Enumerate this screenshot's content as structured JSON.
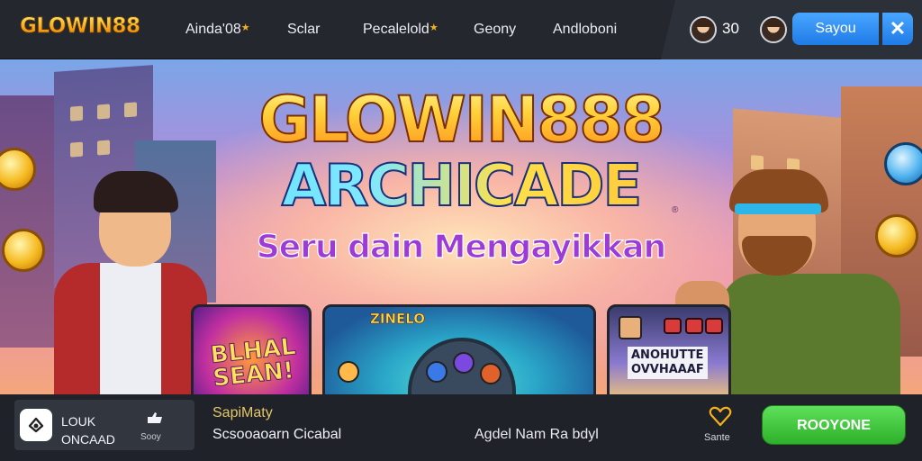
{
  "brand": {
    "logo_text": "GLOWIN88"
  },
  "nav": {
    "items": [
      {
        "label": "Ainda'08",
        "star": true
      },
      {
        "label": "Sclar",
        "star": false
      },
      {
        "label": "Pecalelold",
        "star": true
      },
      {
        "label": "Geony",
        "star": false
      },
      {
        "label": "Andloboni",
        "star": false
      }
    ]
  },
  "header_right": {
    "count": "30",
    "login_label": "Sayou",
    "close_glyph": "✕",
    "icons": [
      "user-avatar-icon",
      "user-avatar-icon",
      "close-icon"
    ]
  },
  "hero": {
    "title_line1": "GLOWIN888",
    "title_line2": "ARCHICADE",
    "registered_mark": "®",
    "subtitle": "Seru dain Mengayikkan",
    "cards": [
      {
        "text_line1": "BLHAL",
        "text_line2": "SEAN!"
      },
      {
        "text": "ZINELO"
      },
      {
        "text_line1": "ANOHUTTE",
        "text_line2": "OVVHAAAF"
      }
    ]
  },
  "bottom_bar": {
    "app_label_line1": "LOUK",
    "app_label_line2": "ONCAAD",
    "thumb_label": "Sooy",
    "promo_title": "SapiMaty",
    "promo_text": "Scsooaoarn Cicabal",
    "center_text": "Agdel Nam Ra bdyl",
    "heart_label": "Sante",
    "cta_label": "ROOYONE"
  },
  "colors": {
    "accent_blue": "#2f8df0",
    "cta_green": "#3cc436",
    "logo_gold": "#f7a516"
  }
}
